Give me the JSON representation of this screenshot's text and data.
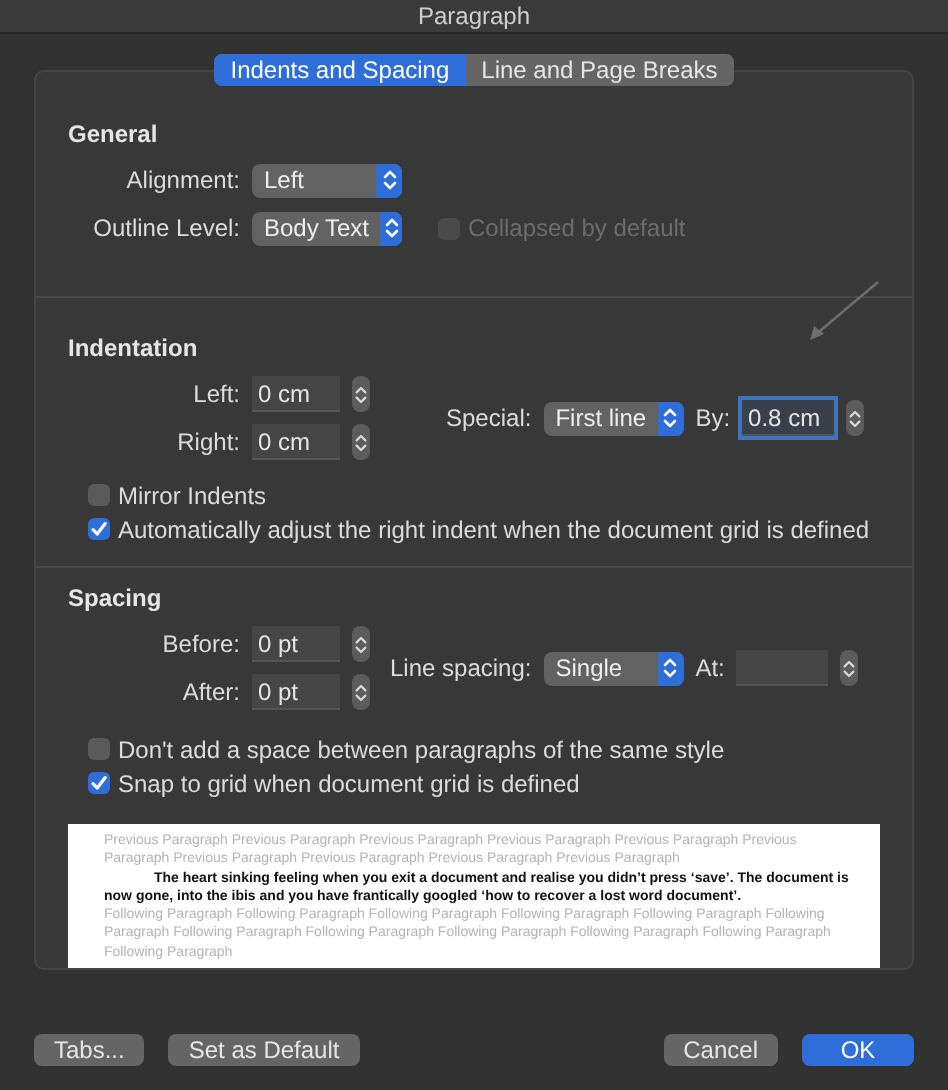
{
  "window": {
    "title": "Paragraph"
  },
  "tabs": [
    {
      "label": "Indents and Spacing",
      "selected": true
    },
    {
      "label": "Line and Page Breaks",
      "selected": false
    }
  ],
  "general": {
    "heading": "General",
    "alignment": {
      "label": "Alignment:",
      "value": "Left"
    },
    "outline_level": {
      "label": "Outline Level:",
      "value": "Body Text"
    },
    "collapsed": {
      "label": "Collapsed by default",
      "checked": false,
      "disabled": true
    }
  },
  "indentation": {
    "heading": "Indentation",
    "left": {
      "label": "Left:",
      "value": "0 cm"
    },
    "right": {
      "label": "Right:",
      "value": "0 cm"
    },
    "special": {
      "label": "Special:",
      "value": "First line"
    },
    "by": {
      "label": "By:",
      "value": "0.8 cm",
      "focused": true
    },
    "options": [
      {
        "label": "Mirror Indents",
        "checked": false
      },
      {
        "label": "Automatically adjust the right indent when the document grid is defined",
        "checked": true
      }
    ]
  },
  "spacing": {
    "heading": "Spacing",
    "before": {
      "label": "Before:",
      "value": "0 pt"
    },
    "after": {
      "label": "After:",
      "value": "0 pt"
    },
    "line_spacing": {
      "label": "Line spacing:",
      "value": "Single"
    },
    "at": {
      "label": "At:"
    },
    "options": [
      {
        "label": "Don't add a space between paragraphs of the same style",
        "checked": false
      },
      {
        "label": "Snap to grid when document grid is defined",
        "checked": true
      }
    ]
  },
  "preview": {
    "previous": "Previous Paragraph Previous Paragraph Previous Paragraph Previous Paragraph Previous Paragraph Previous Paragraph Previous Paragraph Previous Paragraph Previous Paragraph Previous Paragraph",
    "current": "The heart sinking feeling when you exit a document and realise you didn’t press ‘save’. The document is now gone, into the ibis and you have frantically googled ‘how to recover a lost word document’.",
    "following": "Following Paragraph Following Paragraph Following Paragraph Following Paragraph Following Paragraph Following Paragraph Following Paragraph Following Paragraph Following Paragraph Following Paragraph Following Paragraph Following Paragraph"
  },
  "buttons": [
    {
      "label": "Tabs...",
      "kind": "secondary"
    },
    {
      "label": "Set as Default",
      "kind": "secondary"
    },
    {
      "label": "Cancel",
      "kind": "secondary"
    },
    {
      "label": "OK",
      "kind": "primary"
    }
  ]
}
